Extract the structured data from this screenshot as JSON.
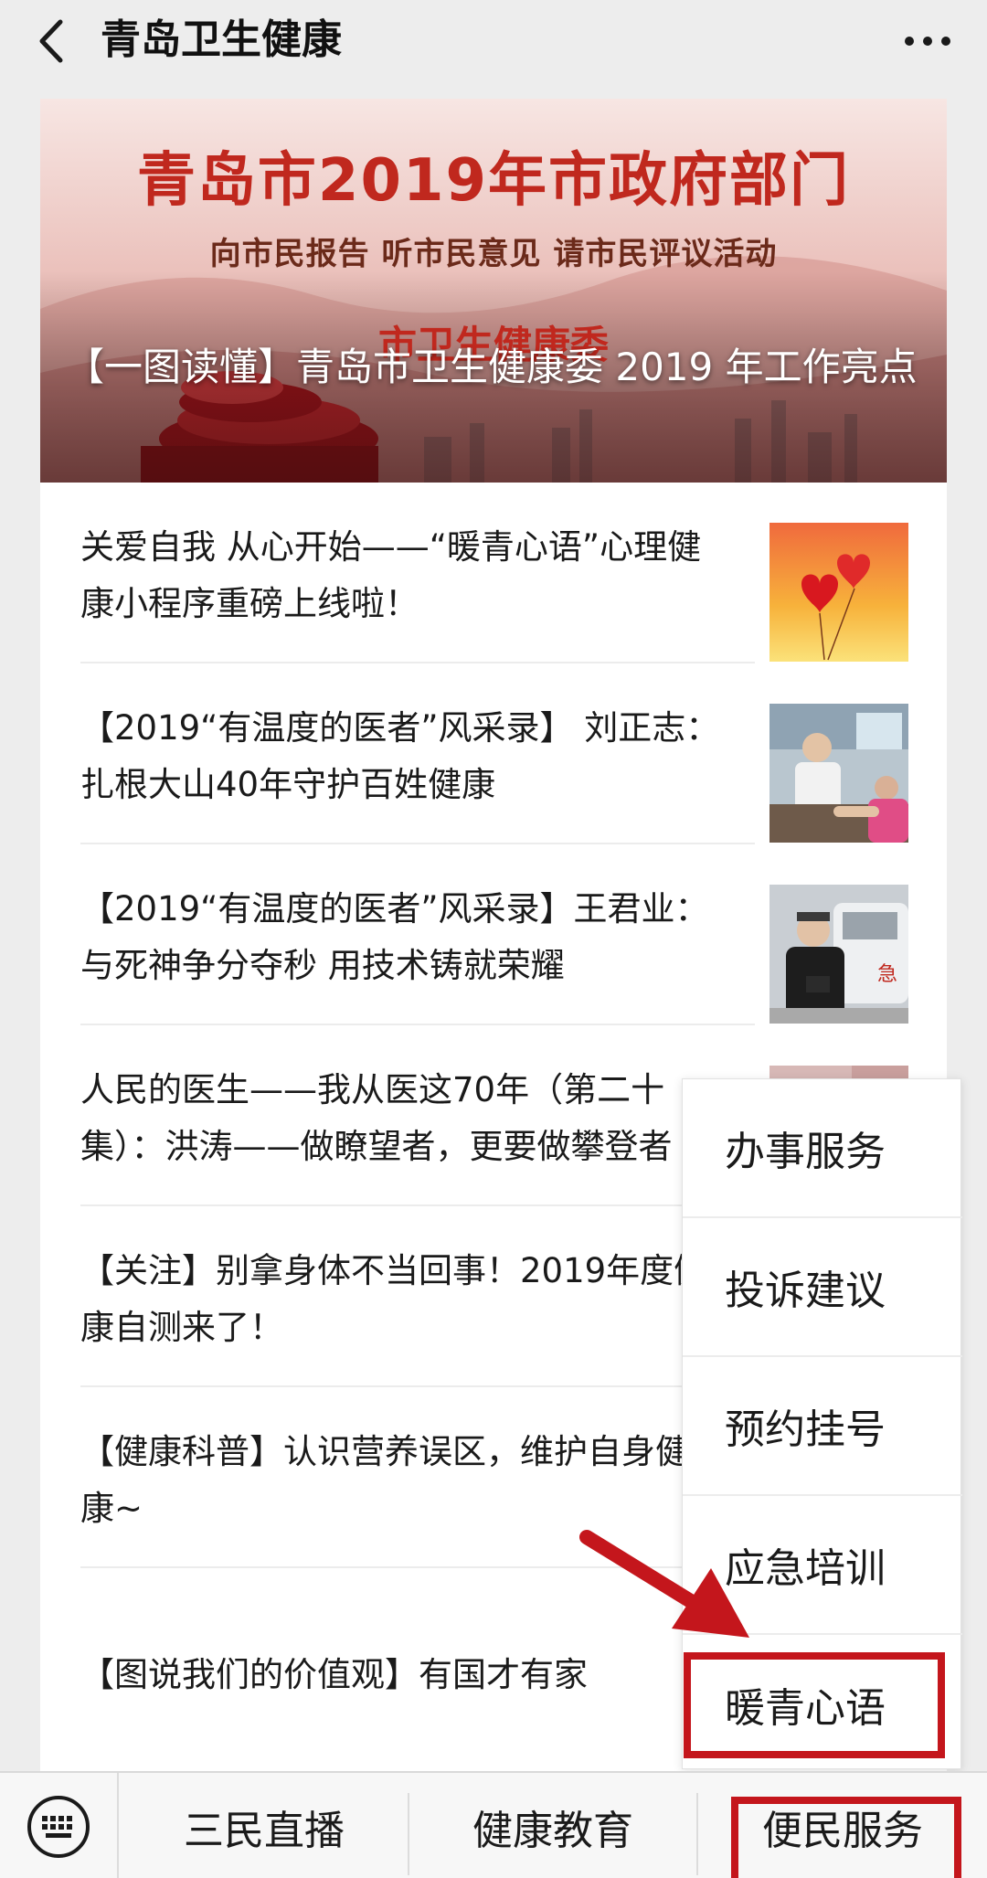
{
  "topbar": {
    "title": "青岛卫生健康",
    "back_icon": "chevron-left-icon",
    "more_icon": "more-dots-icon"
  },
  "banner": {
    "line1": "青岛市2019年市政府部门",
    "line2": "向市民报告 听市民意见 请市民评议活动",
    "line3": "市卫生健康委",
    "caption": "【一图读懂】青岛市卫生健康委 2019 年工作亮点"
  },
  "articles": [
    {
      "title": "关爱自我 从心开始——“暖青心语”心理健康小程序重磅上线啦！",
      "thumb": "hearts-balloon"
    },
    {
      "title": "【2019“有温度的医者”风采录】 刘正志：扎根大山40年守护百姓健康",
      "thumb": "doctor-patient"
    },
    {
      "title": "【2019“有温度的医者”风采录】王君业：与死神争分夺秒 用技术铸就荣耀",
      "thumb": "doctor-ambulance"
    },
    {
      "title": "人民的医生——我从医这70年（第二十集）：洪涛——做瞭望者，更要做攀登者",
      "thumb": "partial"
    },
    {
      "title": "【关注】别拿身体不当回事！2019年度健康自测来了！",
      "thumb": ""
    },
    {
      "title": "【健康科普】认识营养误区，维护自身健康~",
      "thumb": ""
    },
    {
      "title": "【图说我们的价值观】有国才有家",
      "thumb": ""
    }
  ],
  "popup_menu": {
    "items": [
      "办事服务",
      "投诉建议",
      "预约挂号",
      "应急培训",
      "暖青心语"
    ],
    "highlighted": "暖青心语"
  },
  "bottom_menu": {
    "keyboard_icon": "keyboard-icon",
    "tabs": [
      "三民直播",
      "健康教育",
      "便民服务"
    ],
    "highlighted": "便民服务"
  },
  "colors": {
    "accent_red": "#c4161c",
    "background": "#ededed"
  }
}
